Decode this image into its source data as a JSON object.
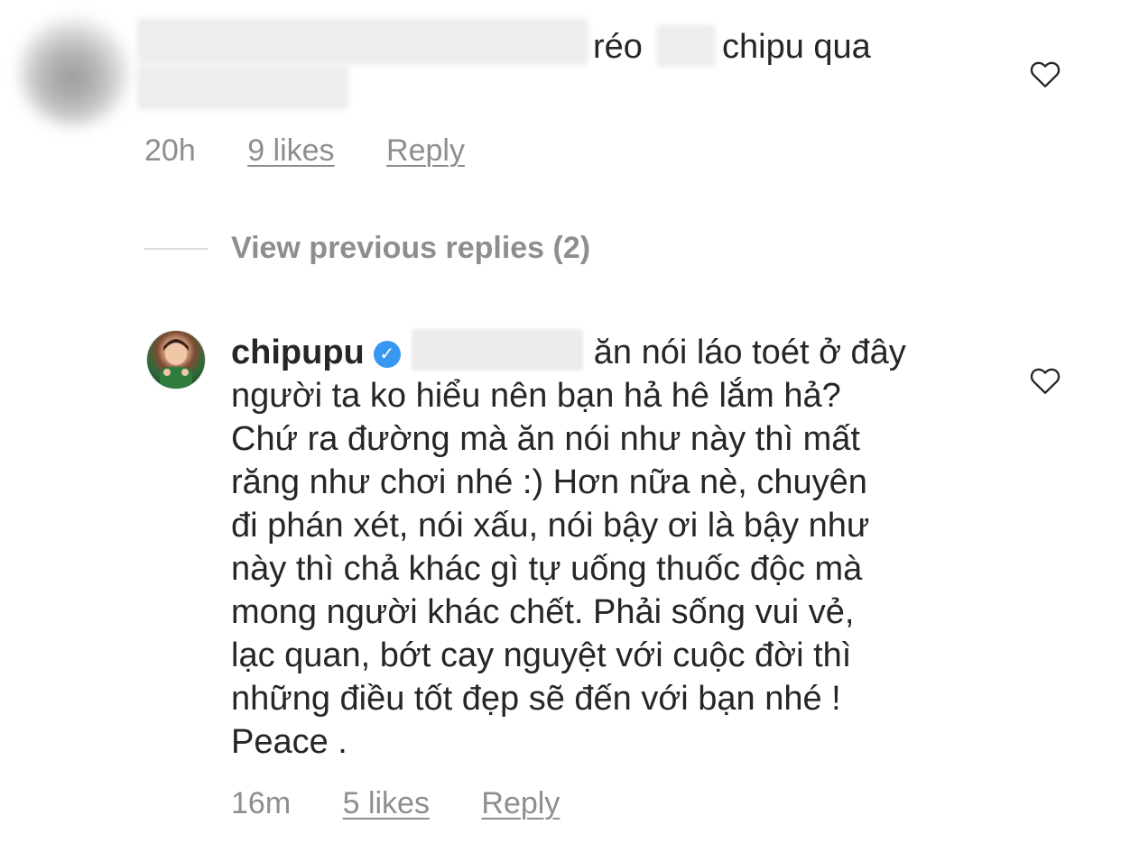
{
  "comment1": {
    "text_after_blur": "réo",
    "text_end": "chipu qua",
    "time": "20h",
    "likes": "9 likes",
    "reply": "Reply"
  },
  "view_previous": "View previous replies (2)",
  "comment2": {
    "username": "chipupu",
    "verified_glyph": "✓",
    "lines": [
      "ăn nói láo toét ở đây",
      "người ta ko hiểu nên bạn hả hê lắm hả?",
      "Chứ ra đường mà ăn nói như này thì mất",
      "răng như chơi nhé :) Hơn nữa nè, chuyên",
      "đi  phán xét, nói xấu, nói bậy ơi là bậy như",
      "này thì chả khác gì tự uống thuốc độc mà",
      "mong người khác chết. Phải sống vui vẻ,",
      "lạc quan, bớt cay nguyệt với cuộc đời thì",
      "những điều tốt đẹp sẽ đến với bạn nhé !",
      "Peace ."
    ],
    "time": "16m",
    "likes": "5 likes",
    "reply": "Reply"
  },
  "icons": {
    "like": "heart-outline-icon",
    "verified": "verified-badge-icon"
  },
  "colors": {
    "text": "#262626",
    "meta": "#8e8e8e",
    "verified": "#3897f0",
    "divider": "#dbdbdb"
  }
}
